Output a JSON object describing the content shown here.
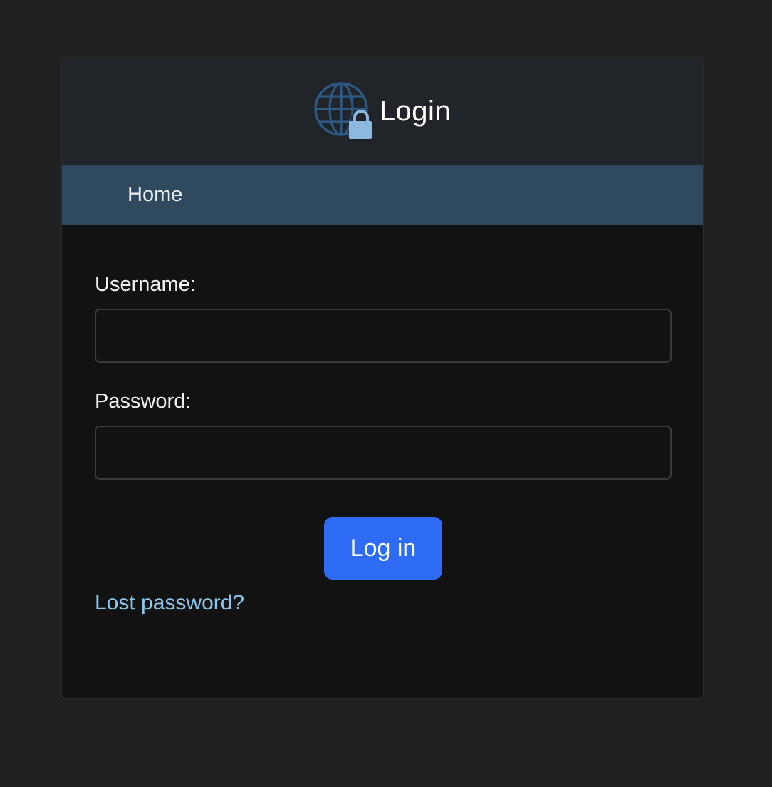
{
  "header": {
    "title": "Login",
    "icon": "globe-lock-icon"
  },
  "nav": {
    "home_label": "Home"
  },
  "form": {
    "username_label": "Username:",
    "username_value": "",
    "password_label": "Password:",
    "password_value": "",
    "submit_label": "Log in",
    "lost_password_label": "Lost password?"
  },
  "colors": {
    "page_bg": "#212121",
    "header_bg": "#212529",
    "nav_bg": "#2f4a5e",
    "button_bg": "#2f6cf5",
    "link": "#8ac7ef"
  }
}
